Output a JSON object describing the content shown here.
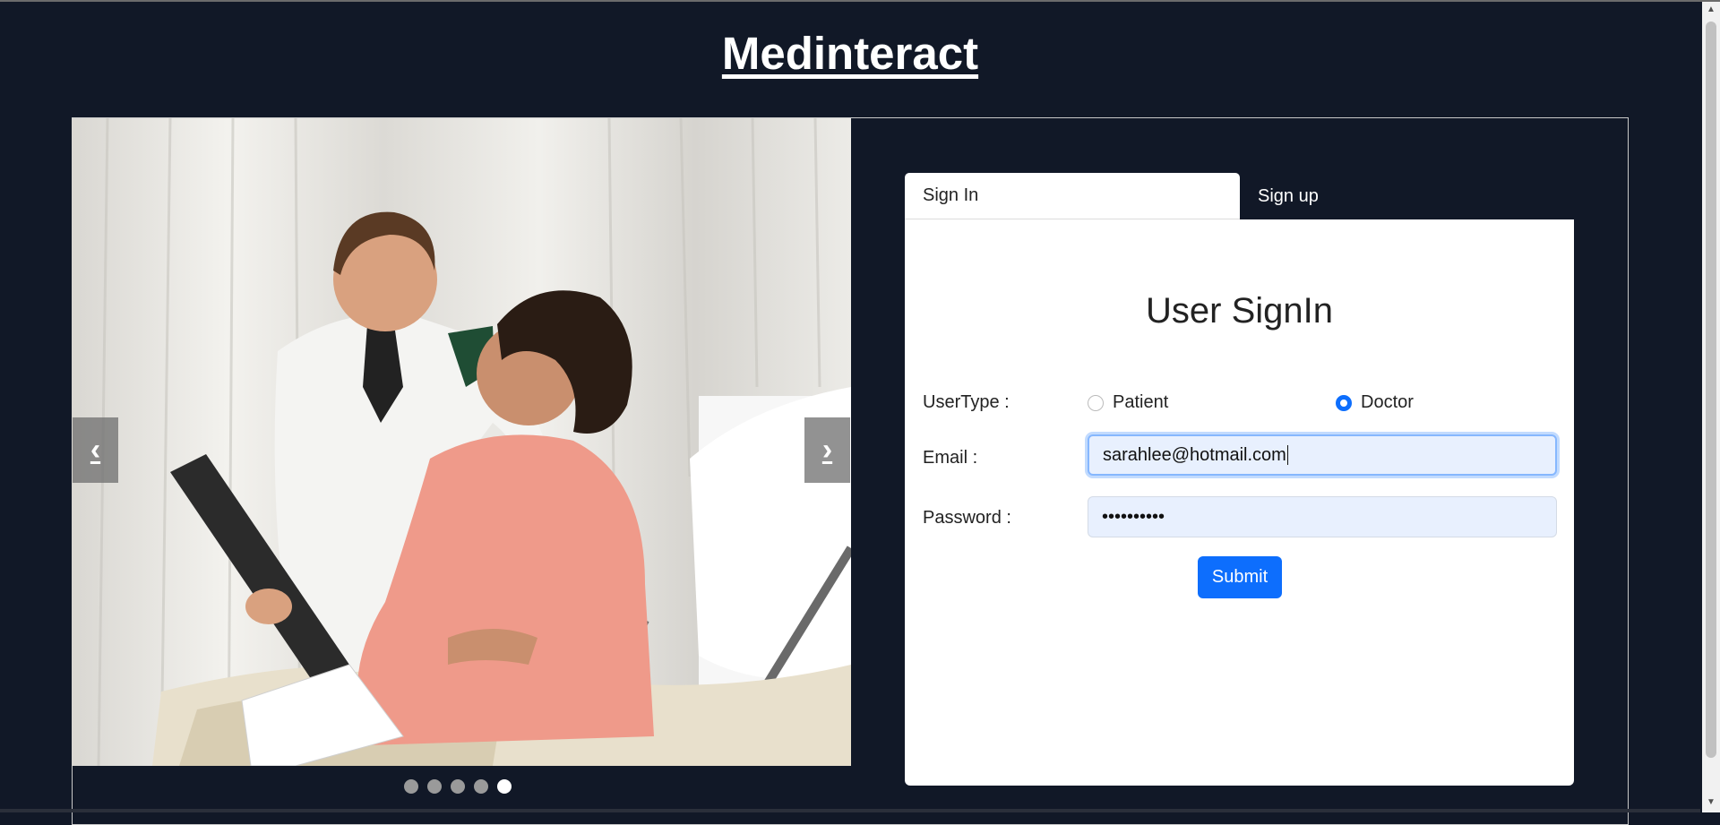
{
  "app": {
    "title": "Medinteract"
  },
  "carousel": {
    "prev_symbol": "‹",
    "next_symbol": "›",
    "slide_count": 5,
    "active_index": 4
  },
  "tabs": [
    {
      "label": "Sign In",
      "active": true
    },
    {
      "label": "Sign up",
      "active": false
    }
  ],
  "form": {
    "title": "User SignIn",
    "usertype_label": "UserType :",
    "options": [
      {
        "label": "Patient",
        "checked": false
      },
      {
        "label": "Doctor",
        "checked": true
      }
    ],
    "email_label": "Email :",
    "email_value": "sarahlee@hotmail.com",
    "password_label": "Password :",
    "password_value": "••••••••••",
    "submit_label": "Submit"
  },
  "colors": {
    "background": "#111827",
    "accent": "#0d6efd",
    "input_fill": "#e8f0fe"
  }
}
